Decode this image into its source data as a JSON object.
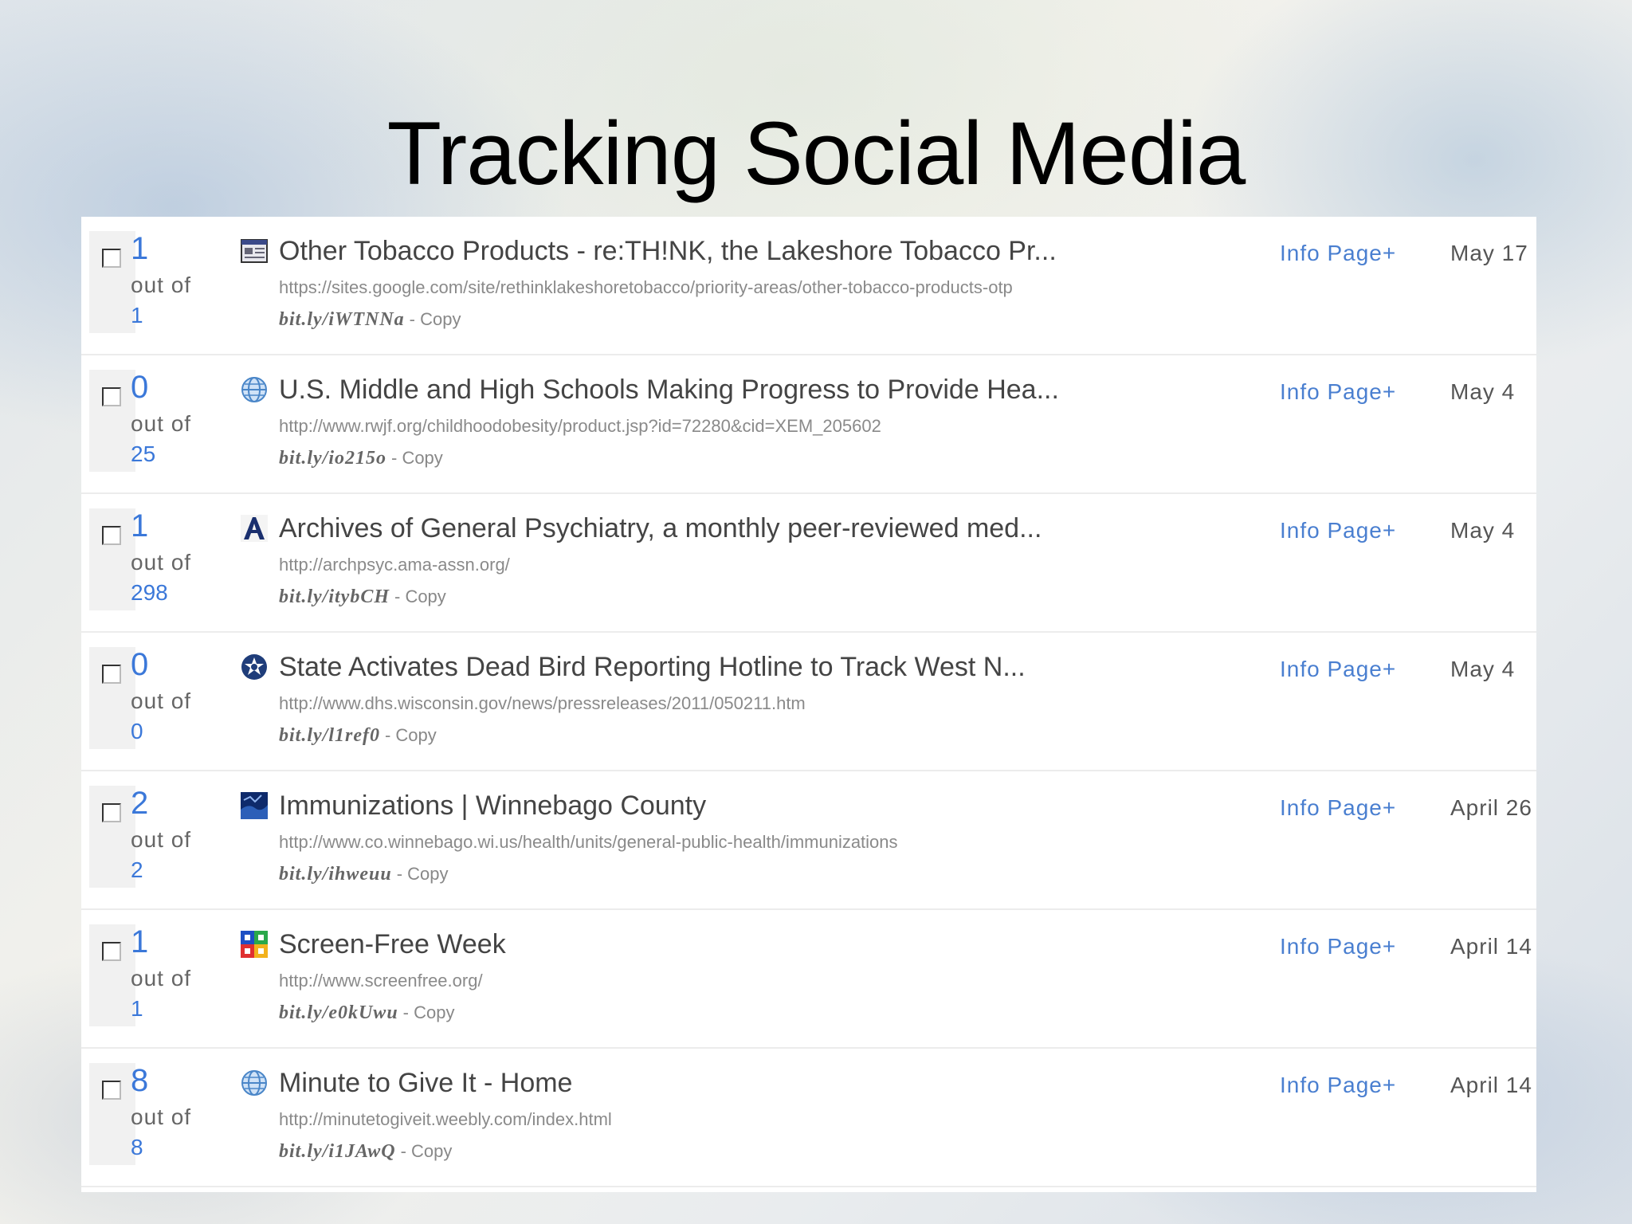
{
  "slide": {
    "title": "Tracking Social Media"
  },
  "out_of_label": "out of",
  "info_label": "Info Page+",
  "copy_label": "- Copy",
  "colors": {
    "link_blue": "#3b78d9",
    "title_text": "#444444",
    "url_gray": "#8a8a8a"
  },
  "links": [
    {
      "clicks": "1",
      "total": "1",
      "favicon": "page-icon",
      "title": "Other Tobacco Products - re:TH!NK, the Lakeshore Tobacco Pr...",
      "url": "https://sites.google.com/site/rethinklakeshoretobacco/priority-areas/other-tobacco-products-otp",
      "short": "bit.ly/iWTNNa",
      "date": "May 17"
    },
    {
      "clicks": "0",
      "total": "25",
      "favicon": "globe-icon",
      "title": "U.S. Middle and High Schools Making Progress to Provide Hea...",
      "url": "http://www.rwjf.org/childhoodobesity/product.jsp?id=72280&cid=XEM_205602",
      "short": "bit.ly/io215o",
      "date": "May 4"
    },
    {
      "clicks": "1",
      "total": "298",
      "favicon": "letter-a-icon",
      "title": "Archives of General Psychiatry, a monthly peer-reviewed med...",
      "url": "http://archpsyc.ama-assn.org/",
      "short": "bit.ly/itybCH",
      "date": "May 4"
    },
    {
      "clicks": "0",
      "total": "0",
      "favicon": "wisconsin-seal-icon",
      "title": "State Activates Dead Bird Reporting Hotline to Track West N...",
      "url": "http://www.dhs.wisconsin.gov/news/pressreleases/2011/050211.htm",
      "short": "bit.ly/l1ref0",
      "date": "May 4"
    },
    {
      "clicks": "2",
      "total": "2",
      "favicon": "county-icon",
      "title": "Immunizations | Winnebago County",
      "url": "http://www.co.winnebago.wi.us/health/units/general-public-health/immunizations",
      "short": "bit.ly/ihweuu",
      "date": "April 26"
    },
    {
      "clicks": "1",
      "total": "1",
      "favicon": "ccfc-icon",
      "title": "Screen-Free Week",
      "url": "http://www.screenfree.org/",
      "short": "bit.ly/e0kUwu",
      "date": "April 14"
    },
    {
      "clicks": "8",
      "total": "8",
      "favicon": "globe-icon",
      "title": "Minute to Give It - Home",
      "url": "http://minutetogiveit.weebly.com/index.html",
      "short": "bit.ly/i1JAwQ",
      "date": "April 14"
    }
  ]
}
